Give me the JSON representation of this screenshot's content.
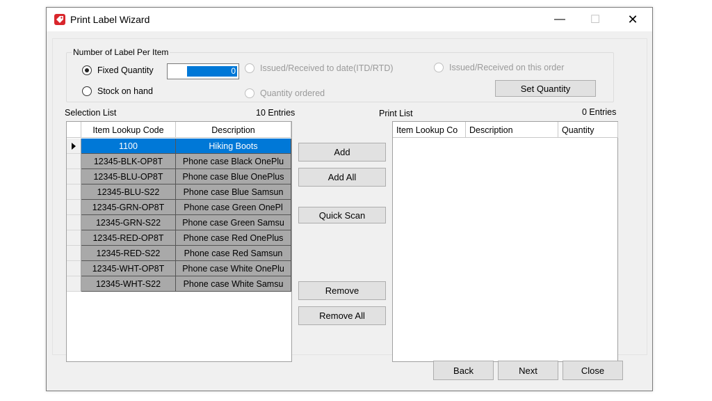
{
  "window": {
    "title": "Print Label Wizard",
    "minimize_glyph": "—",
    "maximize_glyph": "☐",
    "close_glyph": "✕"
  },
  "label_group": {
    "legend": "Number of Label Per Item",
    "fixed_quantity_label": "Fixed Quantity",
    "fixed_quantity_value": "0",
    "stock_on_hand_label": "Stock  on hand",
    "issued_received_itd_label": "Issued/Received to date(ITD/RTD)",
    "quantity_ordered_label": "Quantity ordered",
    "issued_received_order_label": "Issued/Received on this order",
    "set_quantity_label": "Set Quantity",
    "selected_option": "fixed_quantity"
  },
  "selection_list": {
    "title": "Selection List",
    "count": "10 Entries",
    "columns": [
      "Item Lookup Code",
      "Description"
    ],
    "rows": [
      {
        "code": "1100",
        "description": "Hiking Boots",
        "selected": true
      },
      {
        "code": "12345-BLK-OP8T",
        "description": "Phone case Black OnePlu"
      },
      {
        "code": "12345-BLU-OP8T",
        "description": "Phone case Blue OnePlus"
      },
      {
        "code": "12345-BLU-S22",
        "description": "Phone case Blue Samsun"
      },
      {
        "code": "12345-GRN-OP8T",
        "description": "Phone case Green OnePl"
      },
      {
        "code": "12345-GRN-S22",
        "description": "Phone case Green Samsu"
      },
      {
        "code": "12345-RED-OP8T",
        "description": "Phone case Red OnePlus"
      },
      {
        "code": "12345-RED-S22",
        "description": "Phone case Red Samsun"
      },
      {
        "code": "12345-WHT-OP8T",
        "description": "Phone case White OnePlu"
      },
      {
        "code": "12345-WHT-S22",
        "description": "Phone case White Samsu"
      }
    ]
  },
  "actions": {
    "add": "Add",
    "add_all": "Add All",
    "quick_scan": "Quick Scan",
    "remove": "Remove",
    "remove_all": "Remove All"
  },
  "print_list": {
    "title": "Print List",
    "count": "0 Entries",
    "columns": [
      "Item Lookup Co",
      "Description",
      "Quantity"
    ]
  },
  "footer": {
    "back": "Back",
    "next": "Next",
    "close": "Close"
  },
  "colors": {
    "selection": "#0078d7",
    "row_fill": "#a9a9a9",
    "brand_icon": "#d9262c"
  }
}
